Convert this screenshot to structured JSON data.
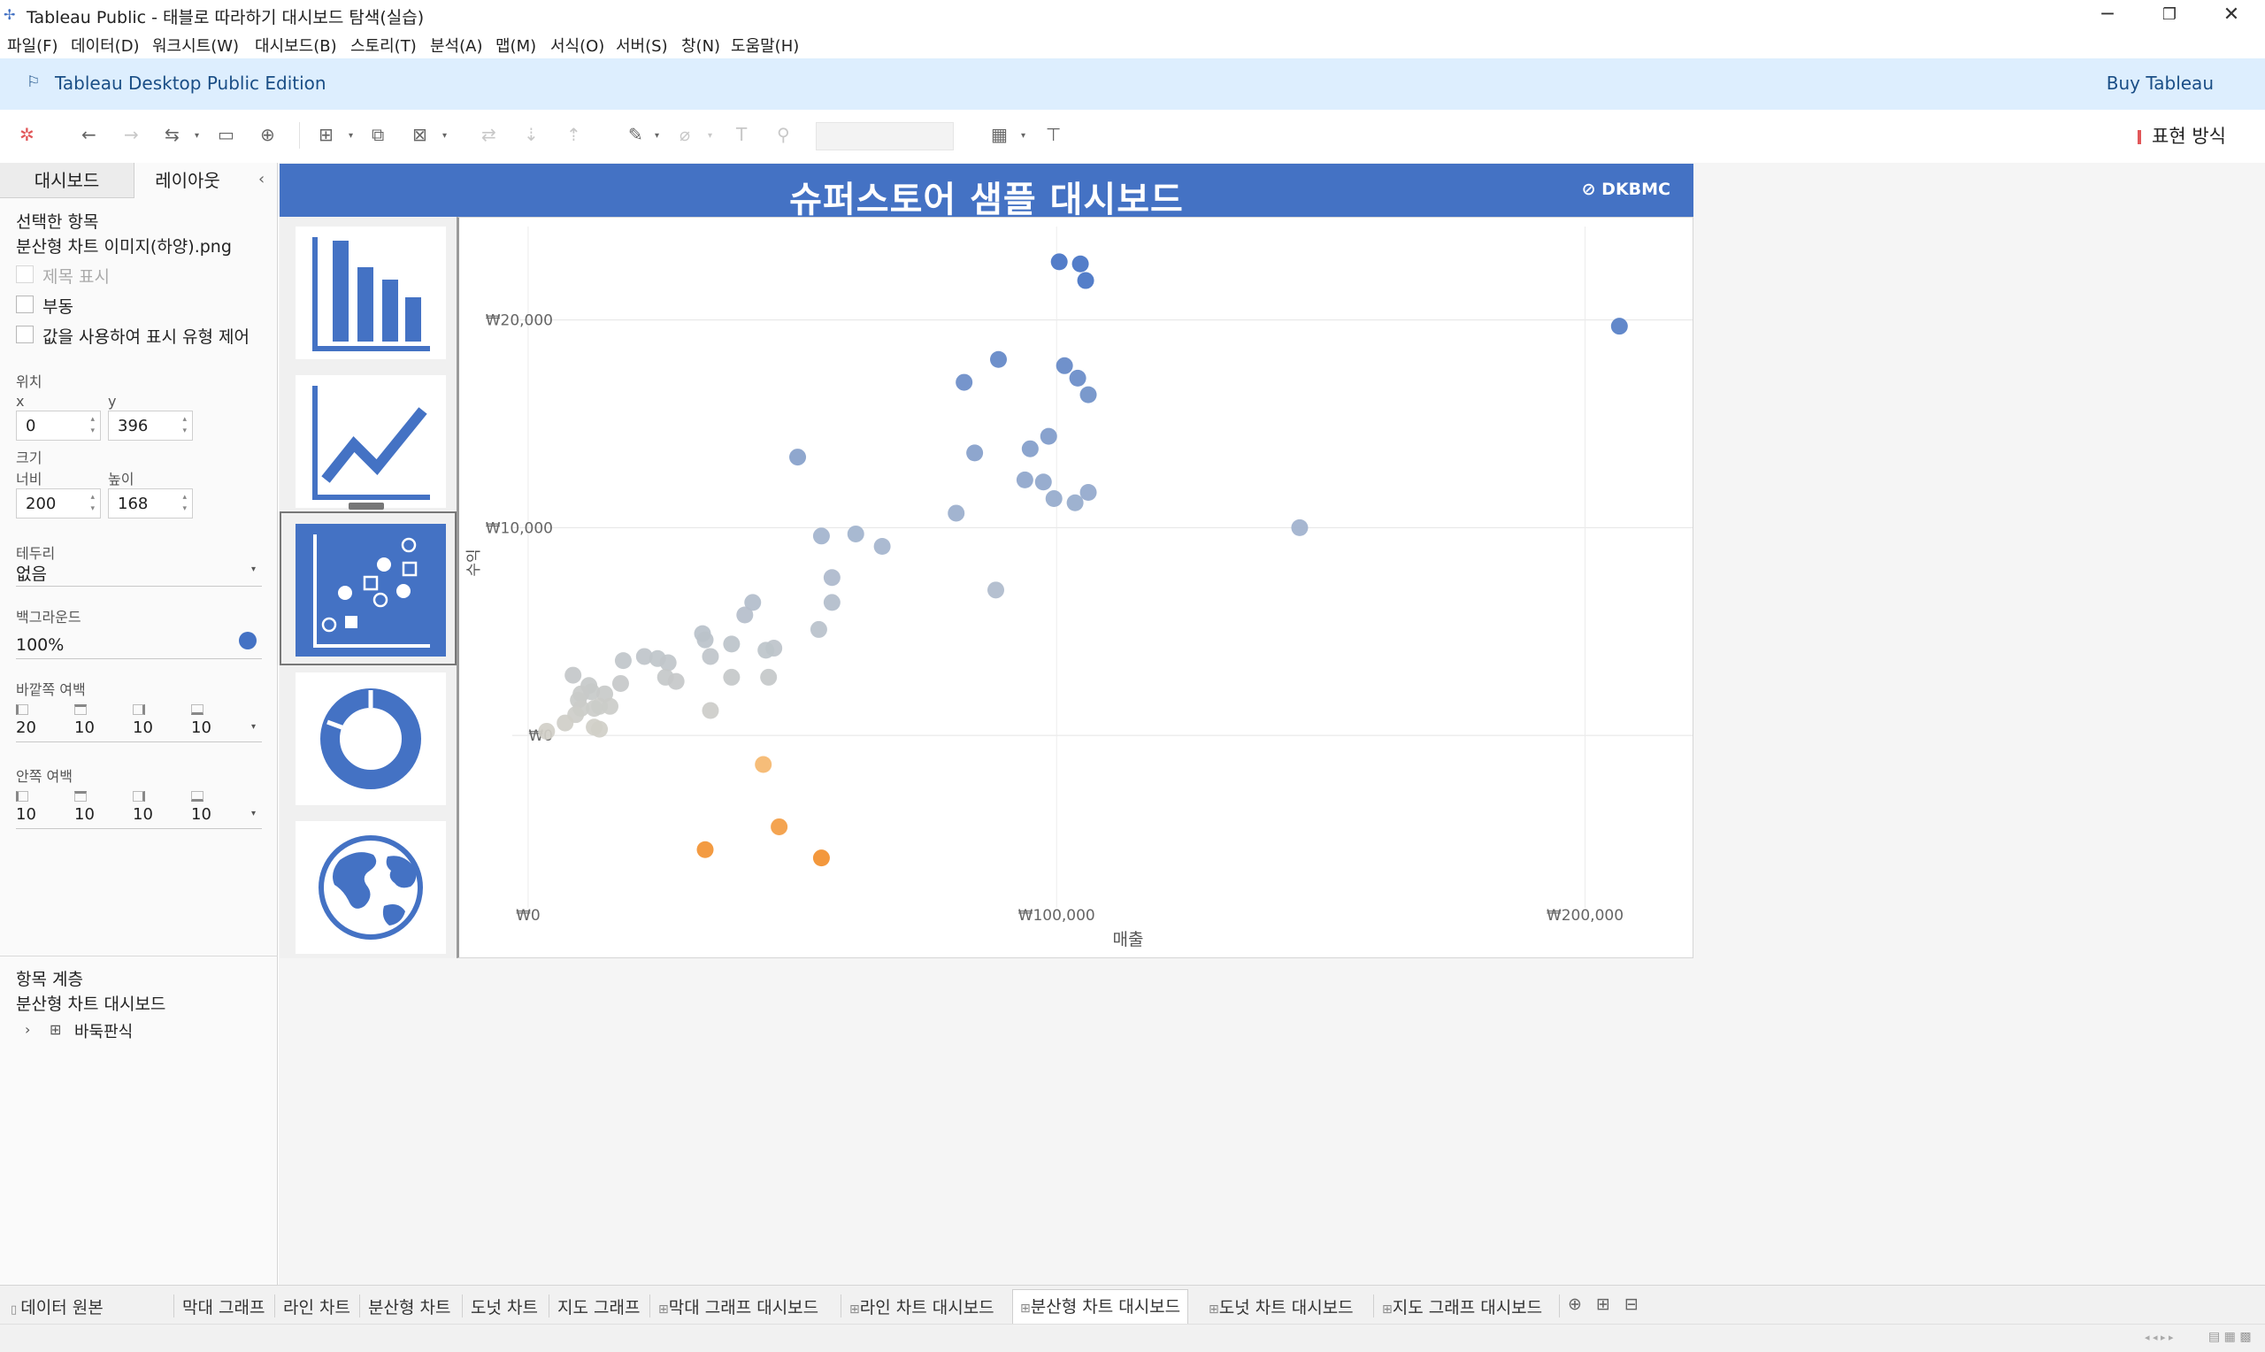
{
  "window": {
    "title": "Tableau Public - 태블로 따라하기 대시보드 탐색(실습)"
  },
  "menu": [
    "파일(F)",
    "데이터(D)",
    "워크시트(W)",
    "대시보드(B)",
    "스토리(T)",
    "분석(A)",
    "맵(M)",
    "서식(O)",
    "서버(S)",
    "창(N)",
    "도움말(H)"
  ],
  "banner": {
    "edition": "Tableau Desktop Public Edition",
    "buy": "Buy Tableau"
  },
  "toolbar": {
    "show_me": "표현 방식"
  },
  "left_panel": {
    "tabs": [
      "대시보드",
      "레이아웃"
    ],
    "selected_item_label": "선택한 항목",
    "selected_item_name": "분산형 차트 이미지(하양).png",
    "show_title": "제목 표시",
    "floating": "부동",
    "control_visibility": "값을 사용하여 표시 유형 제어",
    "position_label": "위치",
    "x_label": "x",
    "y_label": "y",
    "x_value": "0",
    "y_value": "396",
    "size_label": "크기",
    "width_label": "너비",
    "height_label": "높이",
    "width_value": "200",
    "height_value": "168",
    "border_label": "테두리",
    "border_value": "없음",
    "background_label": "백그라운드",
    "background_value": "100%",
    "background_color": "#4472c4",
    "outer_padding_label": "바깥쪽 여백",
    "outer_padding": [
      "20",
      "10",
      "10",
      "10"
    ],
    "inner_padding_label": "안쪽 여백",
    "inner_padding": [
      "10",
      "10",
      "10",
      "10"
    ],
    "hierarchy_label": "항목 계층",
    "hierarchy_root": "분산형 차트 대시보드",
    "hierarchy_child": "바둑판식"
  },
  "dashboard": {
    "title": "슈퍼스토어 샘플 대시보드",
    "logo": "DKBMC",
    "nav_icons": [
      "bar-chart-icon",
      "line-chart-icon",
      "scatter-chart-icon",
      "donut-chart-icon",
      "globe-icon"
    ]
  },
  "chart_data": {
    "type": "scatter",
    "xlabel": "매출",
    "ylabel": "수익",
    "xlim": [
      -3000,
      218000
    ],
    "ylim": [
      -8300,
      24500
    ],
    "x_ticks": [
      "₩0",
      "₩100,000",
      "₩200,000"
    ],
    "x_tick_values": [
      0,
      100000,
      200000
    ],
    "y_ticks": [
      "₩20,000",
      "₩10,000",
      "₩0"
    ],
    "y_tick_values": [
      20000,
      10000,
      0
    ],
    "grid": true,
    "points": [
      [
        100500,
        22800
      ],
      [
        104500,
        22700
      ],
      [
        105500,
        21900
      ],
      [
        206500,
        19700
      ],
      [
        89000,
        18100
      ],
      [
        101500,
        17800
      ],
      [
        104000,
        17200
      ],
      [
        82500,
        17000
      ],
      [
        106000,
        16400
      ],
      [
        95000,
        13800
      ],
      [
        98500,
        14400
      ],
      [
        84500,
        13600
      ],
      [
        51000,
        13400
      ],
      [
        94000,
        12300
      ],
      [
        97500,
        12200
      ],
      [
        99500,
        11400
      ],
      [
        106000,
        11700
      ],
      [
        103500,
        11200
      ],
      [
        81000,
        10700
      ],
      [
        146000,
        10000
      ],
      [
        55500,
        9600
      ],
      [
        62000,
        9700
      ],
      [
        67000,
        9100
      ],
      [
        57500,
        7600
      ],
      [
        88500,
        7000
      ],
      [
        42500,
        6400
      ],
      [
        41000,
        5800
      ],
      [
        57500,
        6400
      ],
      [
        33000,
        4900
      ],
      [
        46500,
        4200
      ],
      [
        55000,
        5100
      ],
      [
        38500,
        4400
      ],
      [
        45000,
        4100
      ],
      [
        33500,
        4600
      ],
      [
        34500,
        3800
      ],
      [
        22000,
        3800
      ],
      [
        18000,
        3600
      ],
      [
        24500,
        3700
      ],
      [
        26500,
        3500
      ],
      [
        45500,
        2800
      ],
      [
        8500,
        2900
      ],
      [
        26000,
        2800
      ],
      [
        28000,
        2600
      ],
      [
        17500,
        2500
      ],
      [
        38500,
        2800
      ],
      [
        11500,
        2400
      ],
      [
        12000,
        2100
      ],
      [
        10000,
        2000
      ],
      [
        14500,
        2000
      ],
      [
        9500,
        1700
      ],
      [
        13500,
        1400
      ],
      [
        12500,
        1300
      ],
      [
        15500,
        1400
      ],
      [
        10000,
        1300
      ],
      [
        34500,
        1200
      ],
      [
        9000,
        1000
      ],
      [
        7000,
        600
      ],
      [
        12500,
        400
      ],
      [
        13500,
        300
      ],
      [
        3500,
        200
      ],
      [
        44500,
        -1400
      ],
      [
        47500,
        -4400
      ],
      [
        33500,
        -5500
      ],
      [
        55500,
        -5900
      ]
    ]
  },
  "sheet_tabs": [
    "데이터 원본",
    "막대 그래프",
    "라인 차트",
    "분산형 차트",
    "도넛 차트",
    "지도 그래프",
    "막대 그래프 대시보드",
    "라인 차트 대시보드",
    "분산형 차트 대시보드",
    "도넛 차트 대시보드",
    "지도 그래프 대시보드"
  ],
  "active_sheet_tab": "분산형 차트 대시보드",
  "colors": {
    "accent": "#4472c4",
    "banner": "#ddeefe",
    "negative": "#f28e2b"
  }
}
